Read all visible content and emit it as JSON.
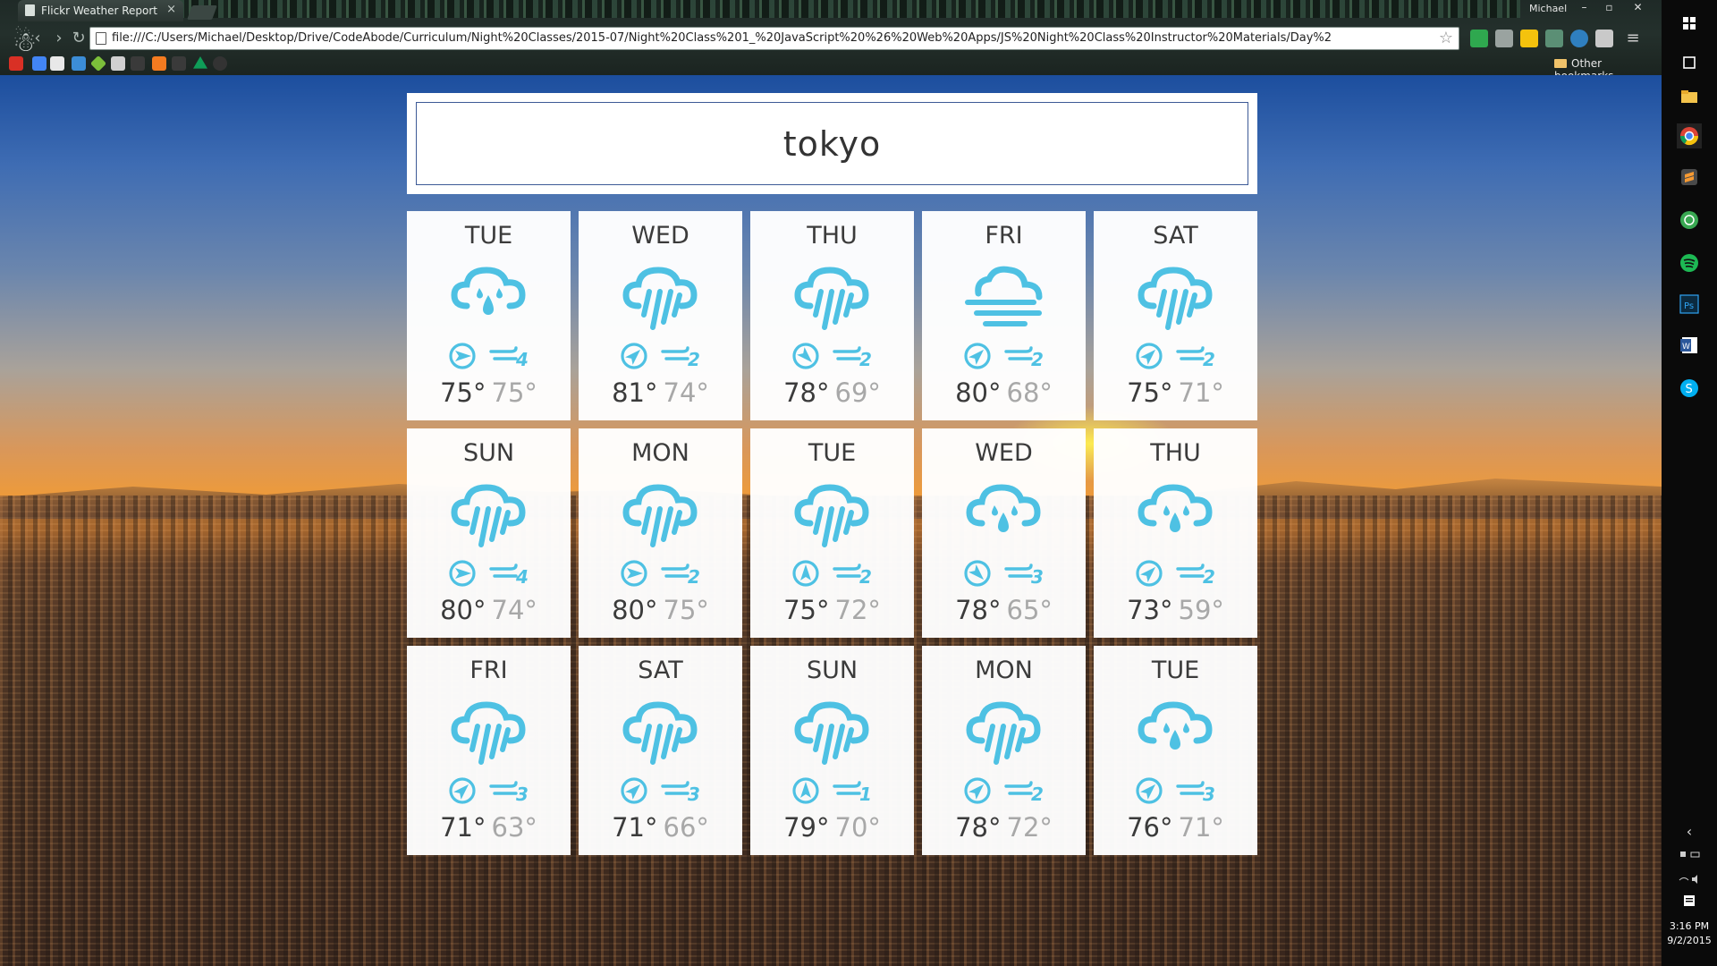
{
  "browser": {
    "tab_title": "Flickr Weather Report",
    "profile_name": "Michael",
    "url": "file:///C:/Users/Michael/Desktop/Drive/CodeAbode/Curriculum/Night%20Classes/2015-07/Night%20Class%201_%20JavaScript%20%26%20Web%20Apps/JS%20Night%20Class%20Instructor%20Materials/Day%2",
    "other_bookmarks": "Other bookmarks"
  },
  "search": {
    "value": "tokyo"
  },
  "colors": {
    "icon": "#4ec1e3",
    "high_temp": "#3b3b3b",
    "low_temp": "#a8a8a8"
  },
  "forecast": [
    {
      "day": "TUE",
      "icon": "raindrops-cloud-icon",
      "wind_dir": "east",
      "wind_speed": "4",
      "high": "75°",
      "low": "75°"
    },
    {
      "day": "WED",
      "icon": "rain-cloud-icon",
      "wind_dir": "northeast",
      "wind_speed": "2",
      "high": "81°",
      "low": "74°"
    },
    {
      "day": "THU",
      "icon": "rain-cloud-icon",
      "wind_dir": "southeast",
      "wind_speed": "2",
      "high": "78°",
      "low": "69°"
    },
    {
      "day": "FRI",
      "icon": "wind-cloud-icon",
      "wind_dir": "northeast",
      "wind_speed": "2",
      "high": "80°",
      "low": "68°"
    },
    {
      "day": "SAT",
      "icon": "rain-cloud-icon",
      "wind_dir": "northeast",
      "wind_speed": "2",
      "high": "75°",
      "low": "71°"
    },
    {
      "day": "SUN",
      "icon": "rain-cloud-icon",
      "wind_dir": "east",
      "wind_speed": "4",
      "high": "80°",
      "low": "74°"
    },
    {
      "day": "MON",
      "icon": "rain-cloud-icon",
      "wind_dir": "east",
      "wind_speed": "2",
      "high": "80°",
      "low": "75°"
    },
    {
      "day": "TUE",
      "icon": "rain-cloud-icon",
      "wind_dir": "north",
      "wind_speed": "2",
      "high": "75°",
      "low": "72°"
    },
    {
      "day": "WED",
      "icon": "raindrops-cloud-icon",
      "wind_dir": "southeast",
      "wind_speed": "3",
      "high": "78°",
      "low": "65°"
    },
    {
      "day": "THU",
      "icon": "raindrops-cloud-icon",
      "wind_dir": "northeast",
      "wind_speed": "2",
      "high": "73°",
      "low": "59°"
    },
    {
      "day": "FRI",
      "icon": "rain-cloud-icon",
      "wind_dir": "northeast",
      "wind_speed": "3",
      "high": "71°",
      "low": "63°"
    },
    {
      "day": "SAT",
      "icon": "rain-cloud-icon",
      "wind_dir": "northeast",
      "wind_speed": "3",
      "high": "71°",
      "low": "66°"
    },
    {
      "day": "SUN",
      "icon": "rain-cloud-icon",
      "wind_dir": "north",
      "wind_speed": "1",
      "high": "79°",
      "low": "70°"
    },
    {
      "day": "MON",
      "icon": "rain-cloud-icon",
      "wind_dir": "northeast",
      "wind_speed": "2",
      "high": "78°",
      "low": "72°"
    },
    {
      "day": "TUE",
      "icon": "raindrops-cloud-icon",
      "wind_dir": "northeast",
      "wind_speed": "3",
      "high": "76°",
      "low": "71°"
    }
  ],
  "taskbar": {
    "time": "3:16 PM",
    "date": "9/2/2015",
    "apps": [
      "windows-icon",
      "task-view-icon",
      "file-explorer-icon",
      "chrome-icon",
      "sublime-icon",
      "green-app-icon",
      "spotify-icon",
      "photoshop-icon",
      "word-icon",
      "skype-icon"
    ]
  }
}
